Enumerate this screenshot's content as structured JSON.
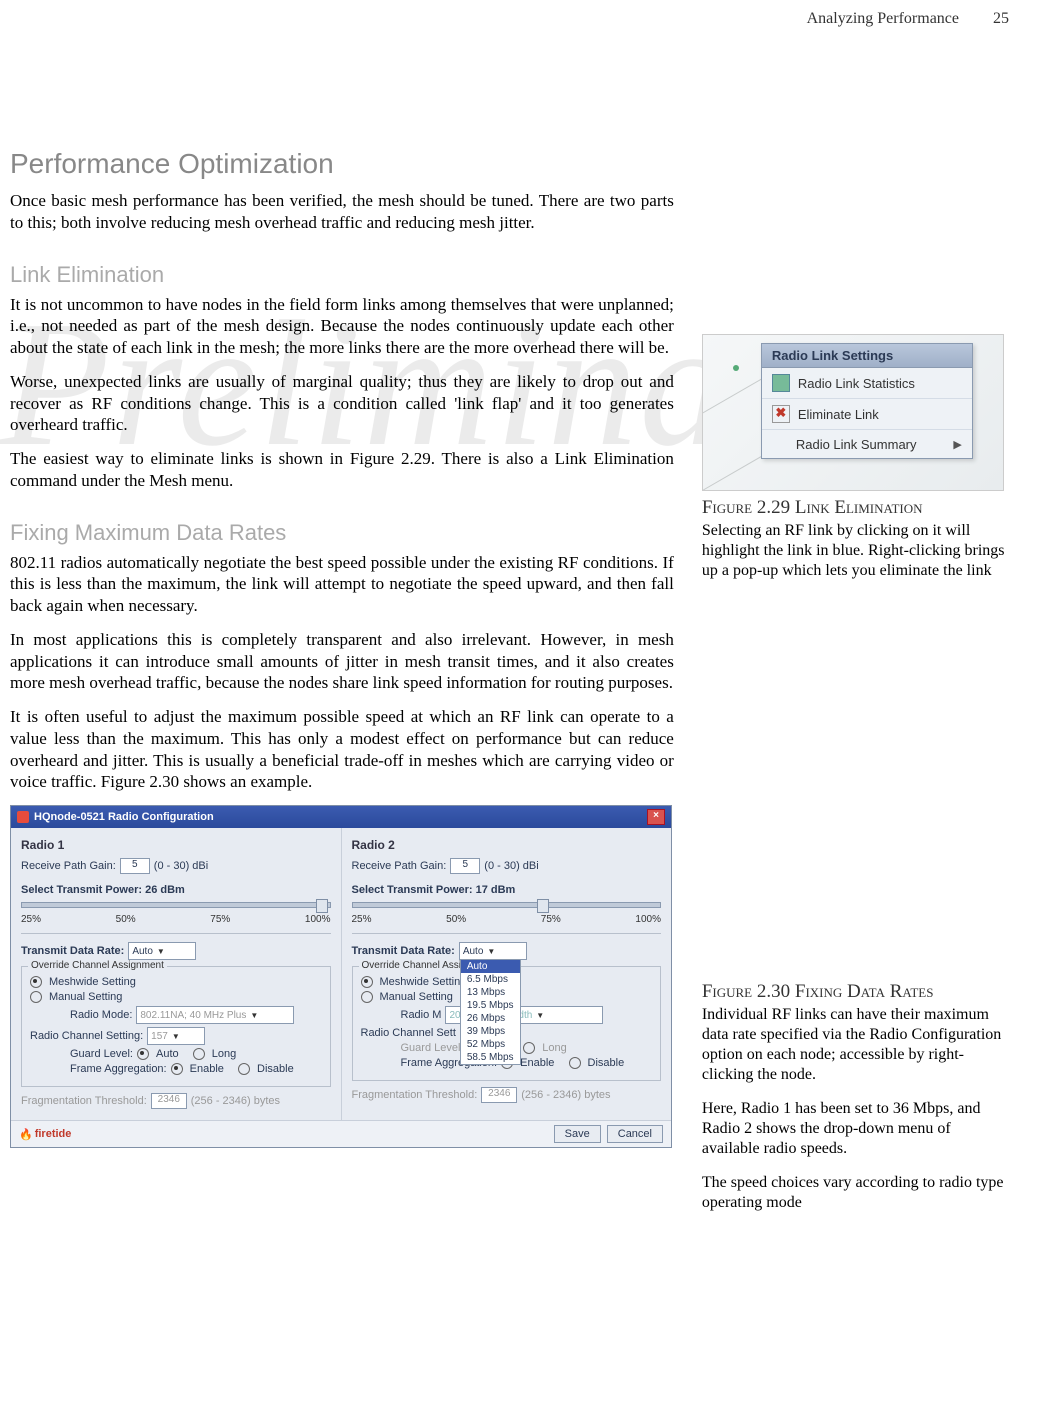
{
  "header": {
    "section": "Analyzing Performance",
    "page": "25"
  },
  "watermark": "Preliminary",
  "h1": "Performance Optimization",
  "intro": "Once basic mesh performance has been verified, the mesh should be tuned. There are two parts to this; both involve reducing mesh overhead traffic and reducing mesh jitter.",
  "sub1": "Link Elimination",
  "p1": "It is not uncommon to have nodes in the field form links among themselves that were unplanned; i.e., not needed as part of the mesh design. Because the nodes continuously update each other about the state of each link in the mesh; the more links there are the more overhead there will be.",
  "p2": "Worse, unexpected links are usually of marginal quality; thus they are likely to drop out and recover as RF conditions change. This is a condition called 'link flap' and it too generates overheard traffic.",
  "p3": "The easiest way to eliminate links is shown in Figure 2.29. There is also a Link Elimination command under the Mesh menu.",
  "sub2": "Fixing Maximum Data Rates",
  "p4": "802.11 radios automatically negotiate the best speed possible under the existing RF conditions. If this is less than the maximum, the link will attempt to negotiate the speed upward, and then fall back again when necessary.",
  "p5": "In most applications this is completely transparent and also irrelevant. However, in mesh applications it can introduce small amounts of jitter in mesh transit times, and it also creates more mesh overhead traffic, because the nodes share link speed information for routing purposes.",
  "p6": "It is often useful to adjust the maximum possible speed at which an RF link can operate to a value less than the maximum. This has only a modest effect on performance but can reduce overheard and jitter. This is usually a beneficial trade-off in meshes which are carrying video or voice traffic. Figure 2.30 shows an example.",
  "fig29": {
    "title": "Figure 2.29 Link Elimination",
    "caption": "Selecting an RF link by clicking on it will highlight the link in blue. Right-clicking brings up a pop-up which lets you eliminate the link",
    "menu": {
      "title": "Radio Link Settings",
      "items": [
        "Radio Link Statistics",
        "Eliminate Link",
        "Radio Link Summary"
      ]
    }
  },
  "fig30": {
    "title": "Figure 2.30 Fixing Data Rates",
    "caption1": "Individual RF links can have their maximum data rate specified via the Radio Configuration option on each node; accessible by right-clicking the node.",
    "caption2": "Here, Radio 1 has been set to 36 Mbps, and Radio 2 shows the drop-down menu of available radio speeds.",
    "caption3": "The speed choices vary according to radio type operating mode"
  },
  "dialog": {
    "title": "HQnode-0521 Radio Configuration",
    "radio1": {
      "title": "Radio 1",
      "rx_label": "Receive Path Gain:",
      "rx_value": "5",
      "rx_unit": "(0 - 30) dBi",
      "tx_label": "Select Transmit Power:   26 dBm",
      "ticks": [
        "25%",
        "50%",
        "75%",
        "100%"
      ],
      "rate_label": "Transmit Data Rate:",
      "rate_value": "Auto",
      "override_legend": "Override Channel Assignment",
      "opt_mesh": "Meshwide Setting",
      "opt_manual": "Manual Setting",
      "mode_label": "Radio Mode:",
      "mode_value": "802.11NA; 40 MHz Plus",
      "chan_label": "Radio Channel Setting:",
      "chan_value": "157",
      "guard_label": "Guard Level:",
      "guard_auto": "Auto",
      "guard_long": "Long",
      "agg_label": "Frame Aggregation:",
      "agg_enable": "Enable",
      "agg_disable": "Disable",
      "frag_label": "Fragmentation Threshold:",
      "frag_value": "2346",
      "frag_range": "(256 - 2346) bytes"
    },
    "radio2": {
      "title": "Radio 2",
      "rx_label": "Receive Path Gain:",
      "rx_value": "5",
      "rx_unit": "(0 - 30) dBi",
      "tx_label": "Select Transmit Power:   17 dBm",
      "ticks": [
        "25%",
        "50%",
        "75%",
        "100%"
      ],
      "rate_label": "Transmit Data Rate:",
      "rate_value": "Auto",
      "rate_options": [
        "Auto",
        "6.5 Mbps",
        "13 Mbps",
        "19.5 Mbps",
        "26 Mbps",
        "39 Mbps",
        "52 Mbps",
        "58.5 Mbps"
      ],
      "override_legend": "Override Channel Assignment",
      "opt_mesh": "Meshwide Setting",
      "opt_manual": "Manual Setting",
      "mode_label": "Radio M",
      "mode_hint": "20 MHz bandwidth",
      "chan_label": "Radio Channel Sett",
      "guard_label": "Guard Level:",
      "guard_auto": "Auto",
      "guard_long": "Long",
      "agg_label": "Frame Aggregation:",
      "agg_enable": "Enable",
      "agg_disable": "Disable",
      "frag_label": "Fragmentation Threshold:",
      "frag_value": "2346",
      "frag_range": "(256 - 2346) bytes"
    },
    "brand": "firetide",
    "save": "Save",
    "cancel": "Cancel"
  }
}
